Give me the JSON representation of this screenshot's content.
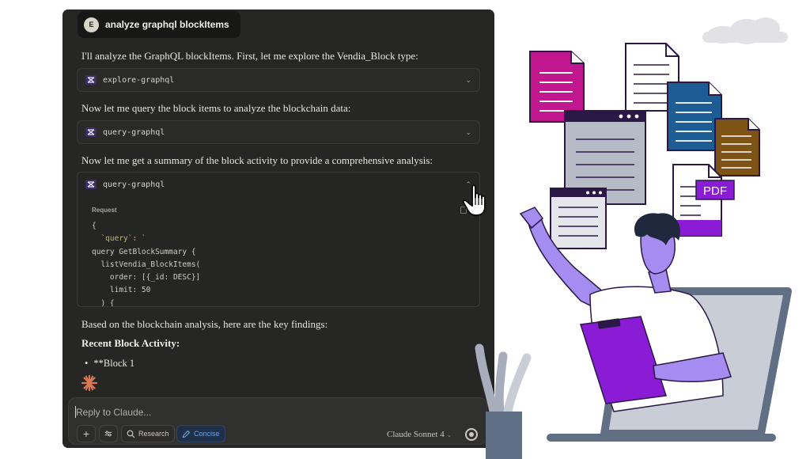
{
  "user_message": {
    "avatar_letter": "E",
    "text": "analyze graphql blockItems"
  },
  "messages": [
    "I'll analyze the GraphQL blockItems. First, let me explore the Vendia_Block type:",
    "Now let me query the block items to analyze the blockchain data:",
    "Now let me get a summary of the block activity to provide a comprehensive analysis:",
    "Based on the blockchain analysis, here are the key findings:"
  ],
  "tools": [
    {
      "name": "explore-graphql"
    },
    {
      "name": "query-graphql"
    },
    {
      "name": "query-graphql"
    }
  ],
  "request": {
    "label": "Request",
    "code": [
      "{",
      "  `query`: `",
      "query GetBlockSummary {",
      "  listVendia_BlockItems(",
      "    order: [{_id: DESC}]",
      "    limit: 50",
      "  ) {"
    ]
  },
  "findings": {
    "heading": "Recent Block Activity:",
    "bullet": "**Block 1"
  },
  "composer": {
    "placeholder": "Reply to Claude...",
    "research_label": "Research",
    "concise_label": "Concise",
    "model_label": "Claude Sonnet 4"
  },
  "illustration": {
    "pdf_label": "PDF"
  },
  "colors": {
    "chat_bg": "#262624",
    "accent_purple": "#8a1cd6",
    "concise_blue": "#6aa6e6"
  }
}
